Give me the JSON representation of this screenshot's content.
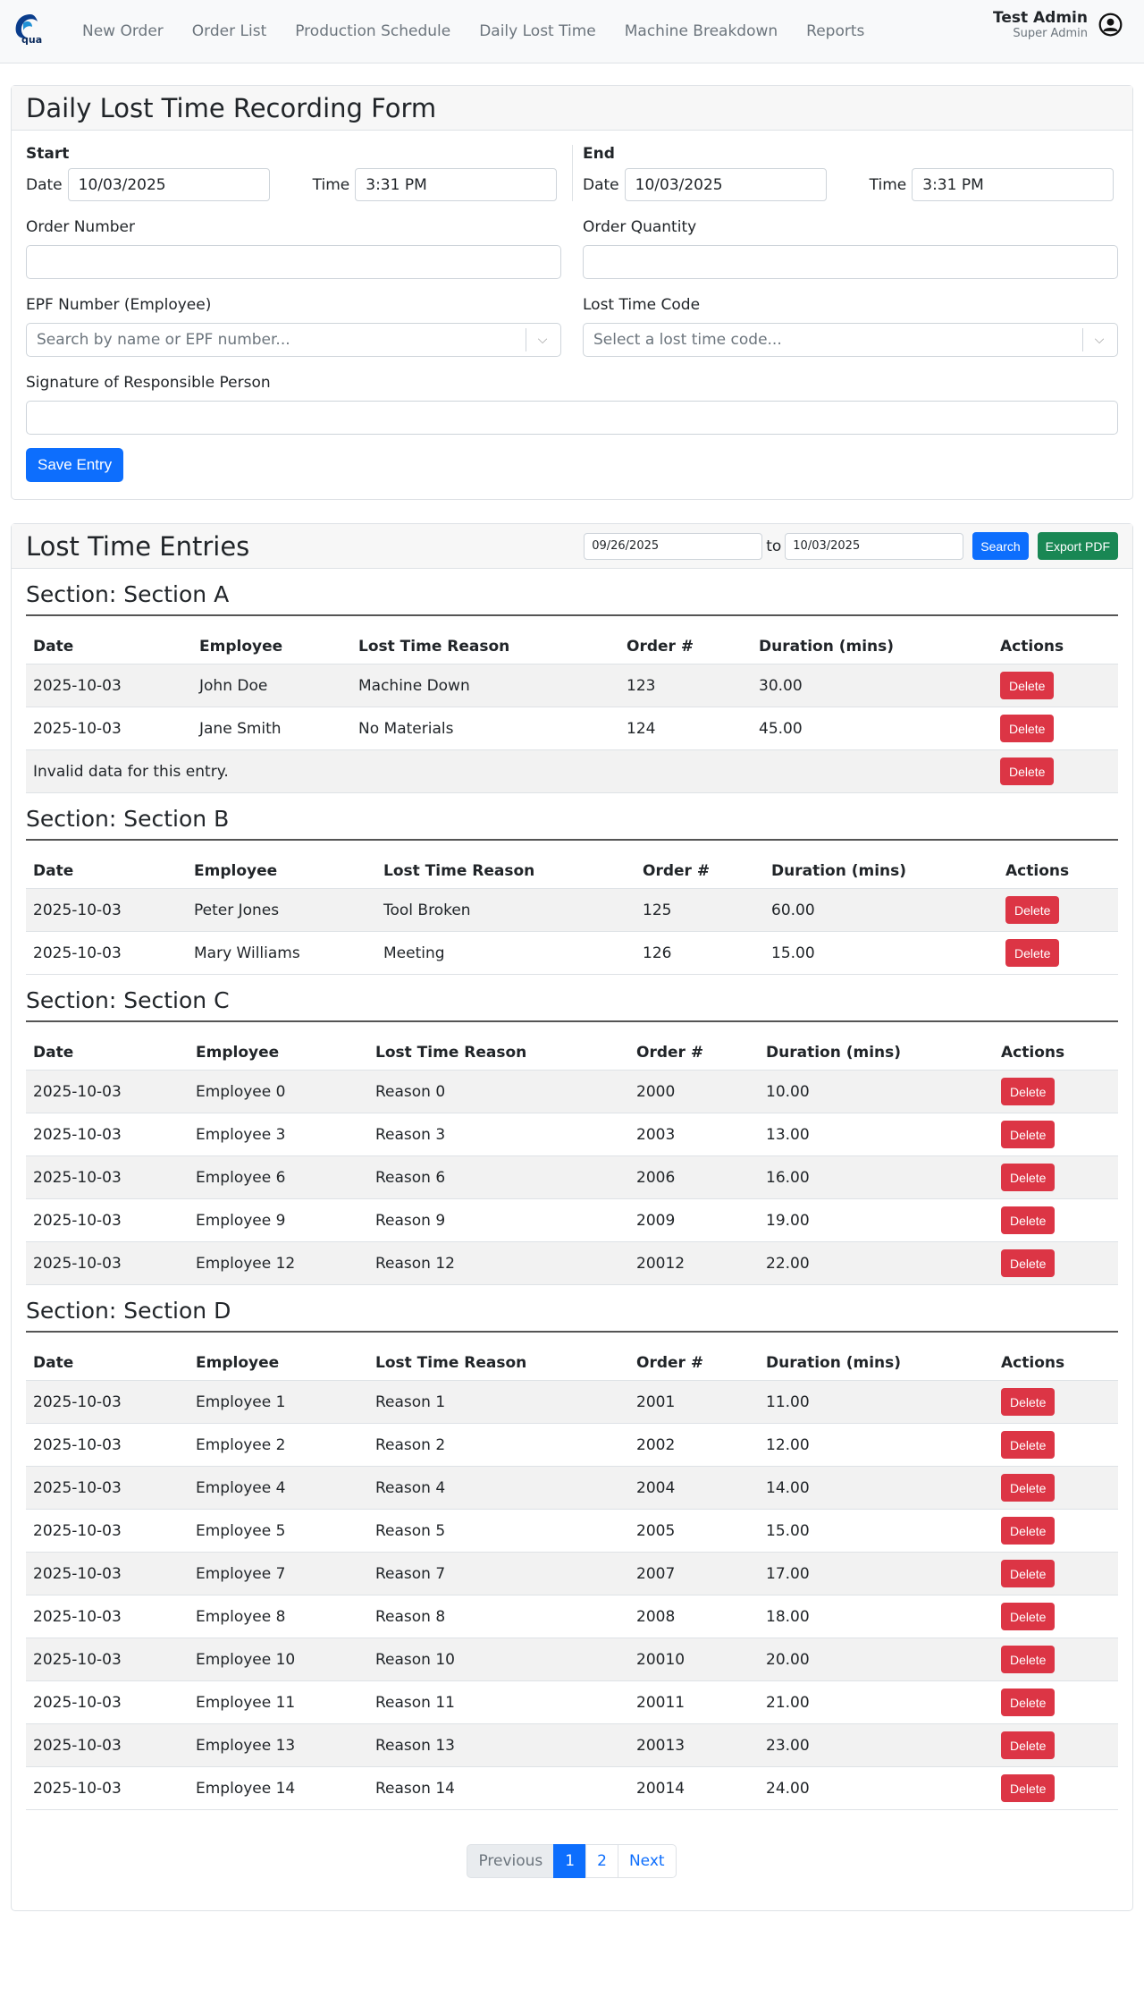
{
  "nav": {
    "logo_text": "qua",
    "links": [
      "New Order",
      "Order List",
      "Production Schedule",
      "Daily Lost Time",
      "Machine Breakdown",
      "Reports"
    ],
    "user_name": "Test Admin",
    "user_role": "Super Admin"
  },
  "form": {
    "title": "Daily Lost Time Recording Form",
    "start_label": "Start",
    "end_label": "End",
    "date_label": "Date",
    "time_label": "Time",
    "start_date": "10/03/2025",
    "start_time": "3:31 PM",
    "end_date": "10/03/2025",
    "end_time": "3:31 PM",
    "order_number_label": "Order Number",
    "order_quantity_label": "Order Quantity",
    "epf_label": "EPF Number (Employee)",
    "epf_placeholder": "Search by name or EPF number...",
    "lost_code_label": "Lost Time Code",
    "lost_code_placeholder": "Select a lost time code...",
    "signature_label": "Signature of Responsible Person",
    "save_label": "Save Entry"
  },
  "entries": {
    "title": "Lost Time Entries",
    "from_date": "09/26/2025",
    "to_label": "to",
    "to_date": "10/03/2025",
    "search_label": "Search",
    "export_label": "Export PDF",
    "columns": [
      "Date",
      "Employee",
      "Lost Time Reason",
      "Order #",
      "Duration (mins)",
      "Actions"
    ],
    "delete_label": "Delete",
    "sections": [
      {
        "title": "Section: Section A",
        "widths": [
          186,
          178,
          300,
          148,
          270,
          140
        ],
        "rows": [
          [
            "2025-10-03",
            "John Doe",
            "Machine Down",
            "123",
            "30.00"
          ],
          [
            "2025-10-03",
            "Jane Smith",
            "No Materials",
            "124",
            "45.00"
          ],
          {
            "message": "Invalid data for this entry."
          }
        ]
      },
      {
        "title": "Section: Section B",
        "widths": [
          180,
          212,
          290,
          144,
          262,
          134
        ],
        "rows": [
          [
            "2025-10-03",
            "Peter Jones",
            "Tool Broken",
            "125",
            "60.00"
          ],
          [
            "2025-10-03",
            "Mary Williams",
            "Meeting",
            "126",
            "15.00"
          ]
        ]
      },
      {
        "title": "Section: Section C",
        "widths": [
          182,
          201,
          292,
          145,
          263,
          139
        ],
        "rows": [
          [
            "2025-10-03",
            "Employee 0",
            "Reason 0",
            "2000",
            "10.00"
          ],
          [
            "2025-10-03",
            "Employee 3",
            "Reason 3",
            "2003",
            "13.00"
          ],
          [
            "2025-10-03",
            "Employee 6",
            "Reason 6",
            "2006",
            "16.00"
          ],
          [
            "2025-10-03",
            "Employee 9",
            "Reason 9",
            "2009",
            "19.00"
          ],
          [
            "2025-10-03",
            "Employee 12",
            "Reason 12",
            "20012",
            "22.00"
          ]
        ]
      },
      {
        "title": "Section: Section D",
        "widths": [
          182,
          201,
          292,
          145,
          263,
          139
        ],
        "rows": [
          [
            "2025-10-03",
            "Employee 1",
            "Reason 1",
            "2001",
            "11.00"
          ],
          [
            "2025-10-03",
            "Employee 2",
            "Reason 2",
            "2002",
            "12.00"
          ],
          [
            "2025-10-03",
            "Employee 4",
            "Reason 4",
            "2004",
            "14.00"
          ],
          [
            "2025-10-03",
            "Employee 5",
            "Reason 5",
            "2005",
            "15.00"
          ],
          [
            "2025-10-03",
            "Employee 7",
            "Reason 7",
            "2007",
            "17.00"
          ],
          [
            "2025-10-03",
            "Employee 8",
            "Reason 8",
            "2008",
            "18.00"
          ],
          [
            "2025-10-03",
            "Employee 10",
            "Reason 10",
            "20010",
            "20.00"
          ],
          [
            "2025-10-03",
            "Employee 11",
            "Reason 11",
            "20011",
            "21.00"
          ],
          [
            "2025-10-03",
            "Employee 13",
            "Reason 13",
            "20013",
            "23.00"
          ],
          [
            "2025-10-03",
            "Employee 14",
            "Reason 14",
            "20014",
            "24.00"
          ]
        ]
      }
    ]
  },
  "pagination": {
    "previous": "Previous",
    "pages": [
      "1",
      "2"
    ],
    "active": "1",
    "next": "Next"
  }
}
